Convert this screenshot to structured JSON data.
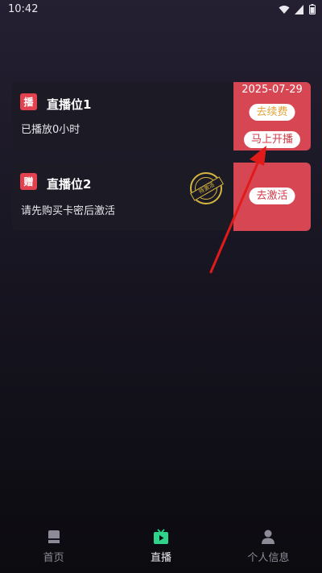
{
  "status_bar": {
    "time": "10:42",
    "icons": [
      "wifi-icon",
      "signal-icon",
      "battery-icon"
    ]
  },
  "slots": [
    {
      "badge": "播",
      "title": "直播位1",
      "subtitle": "已播放0小时",
      "expiry_date": "2025-07-29",
      "renew_label": "去续费",
      "start_label": "马上开播"
    },
    {
      "badge": "赠",
      "title": "直播位2",
      "subtitle": "请先购买卡密后激活",
      "stamp_text": "待激活",
      "activate_label": "去激活"
    }
  ],
  "bottom_nav": {
    "items": [
      {
        "label": "首页",
        "icon": "home-icon"
      },
      {
        "label": "直播",
        "icon": "tv-icon",
        "active": true
      },
      {
        "label": "个人信息",
        "icon": "user-icon"
      }
    ]
  },
  "colors": {
    "accent_red": "#d74753",
    "badge_red": "#e2424f",
    "renew_orange": "#e2a43a",
    "stamp_gold": "#d4b640",
    "active_nav_green": "#2fd38a"
  }
}
